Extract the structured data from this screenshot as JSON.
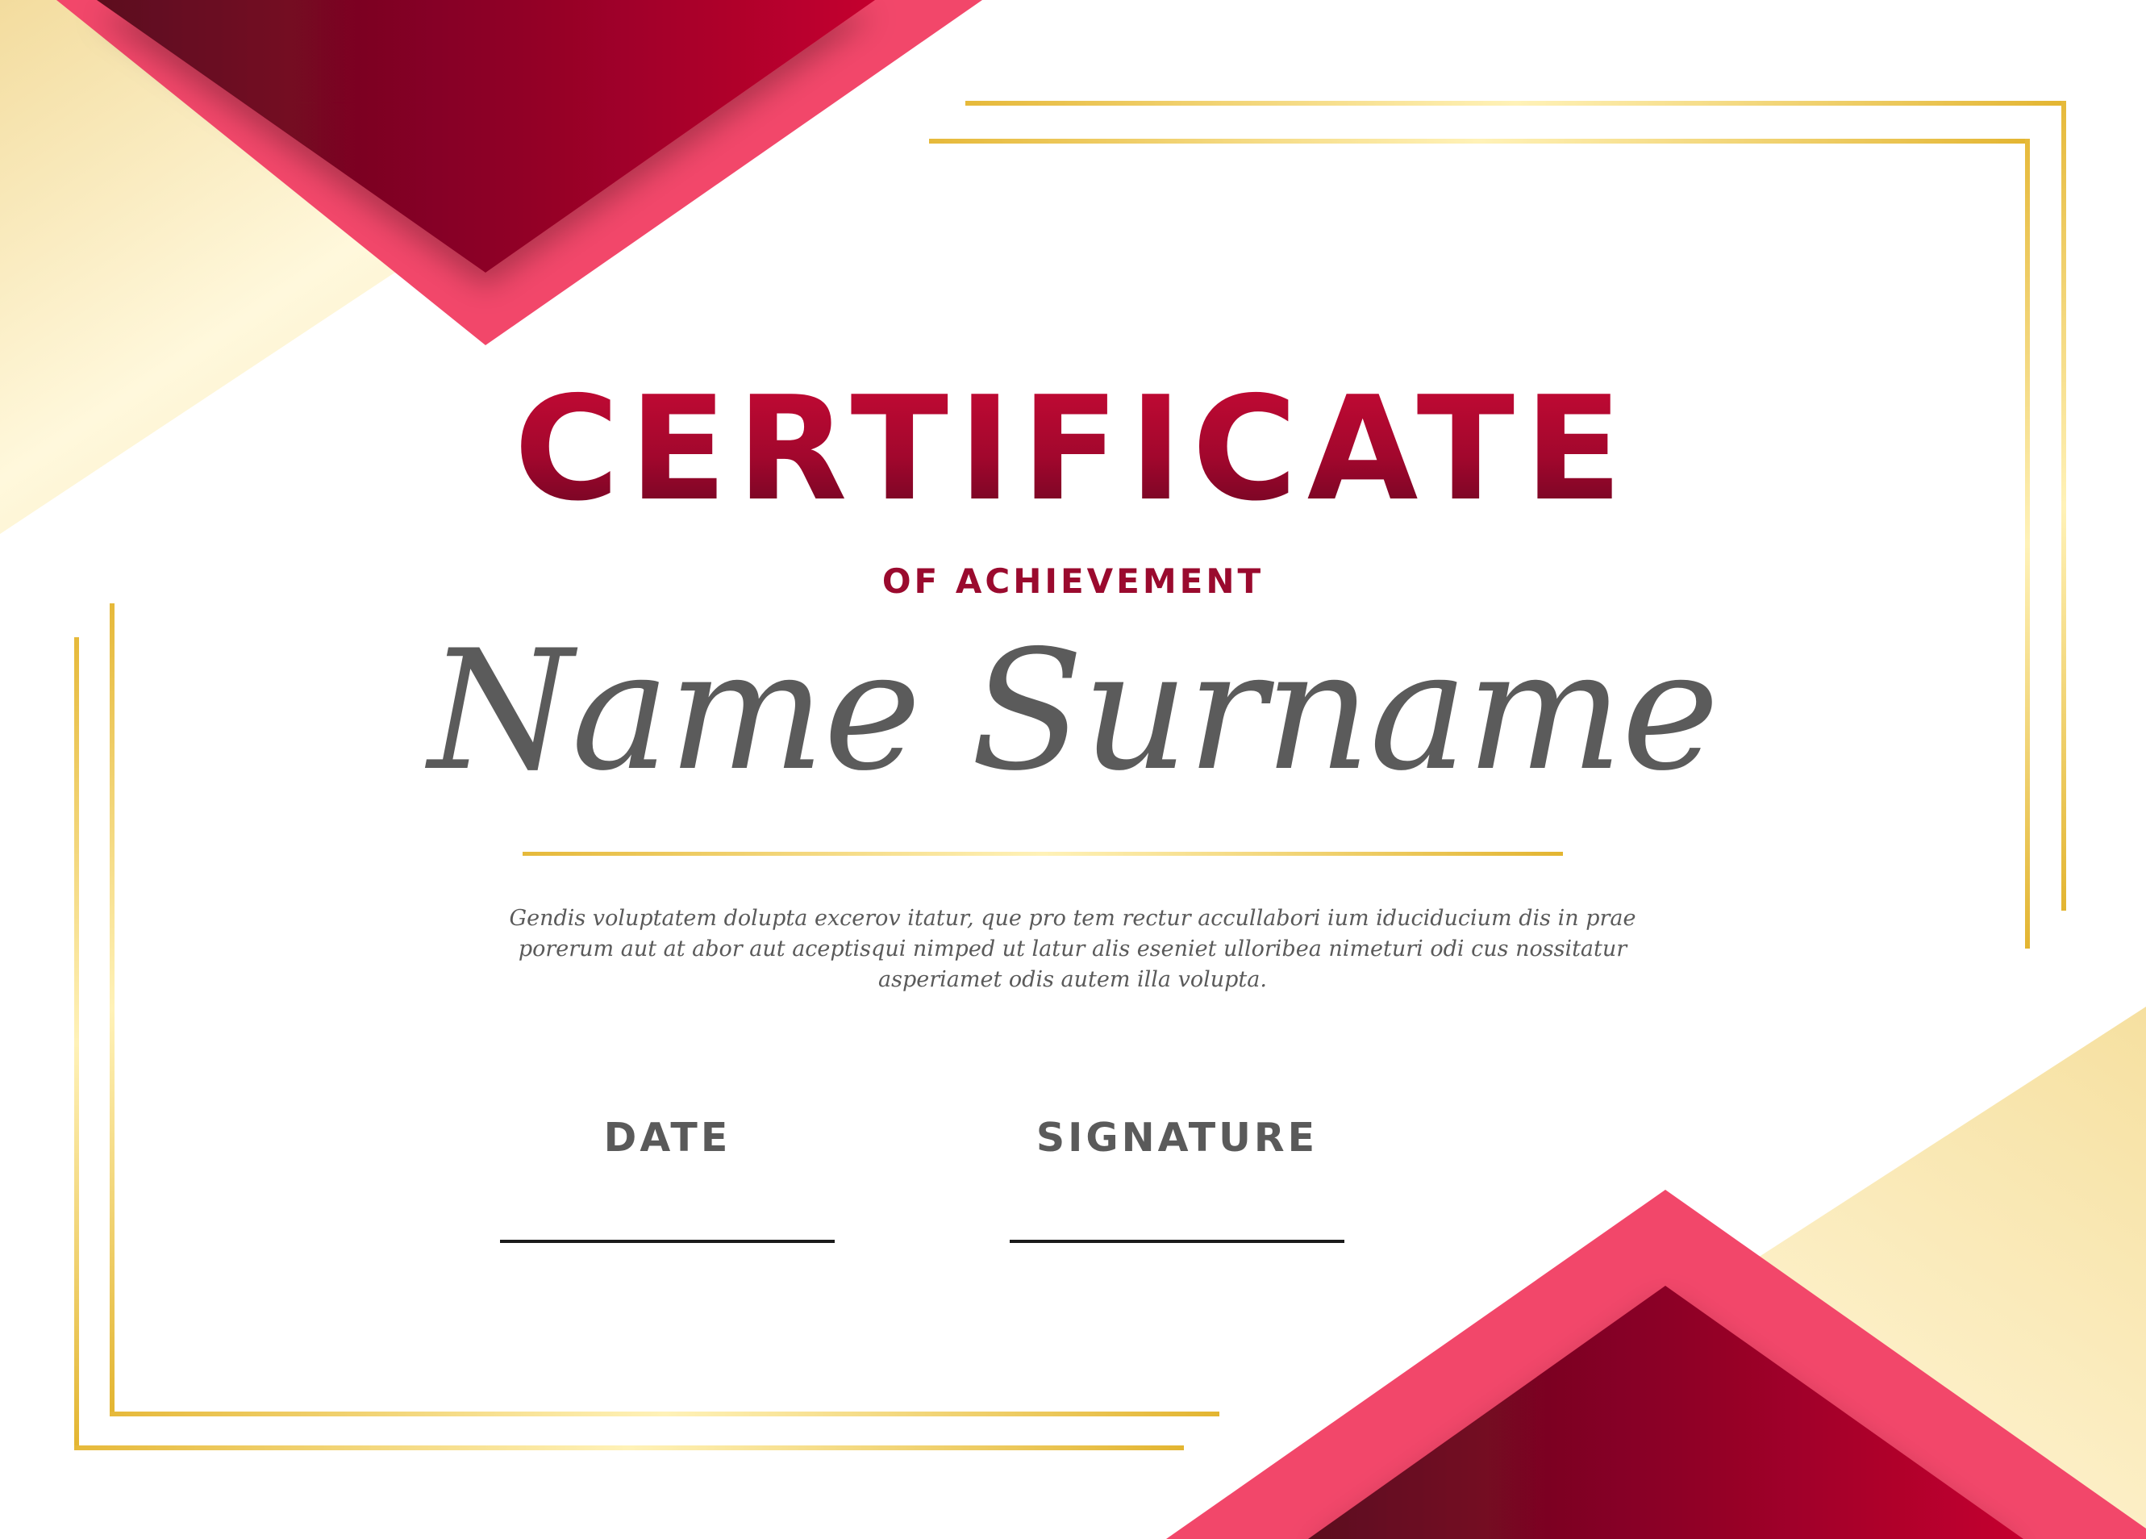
{
  "certificate": {
    "title": "CERTIFICATE",
    "subtitle": "OF ACHIEVEMENT",
    "recipient_name": "Name Surname",
    "body_text": "Gendis voluptatem dolupta excerov itatur, que pro tem rectur accullabori ium iduciducium dis in prae porerum aut at abor aut aceptisqui nimped ut latur alis eseniet ulloribea nimeturi odi cus nossitatur asperiamet odis autem illa volupta.",
    "date_label": "DATE",
    "signature_label": "SIGNATURE"
  },
  "colors": {
    "crimson": "#a2072d",
    "pink": "#f2476a",
    "gold": "#e8bd3c",
    "cream": "#f7e3a6",
    "text_gray": "#5a5a5a",
    "background": "#ffffff"
  }
}
